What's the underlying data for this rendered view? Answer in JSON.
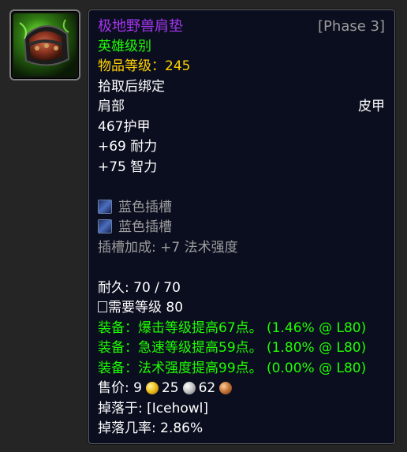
{
  "item": {
    "icon_name": "shoulder-armor-icon",
    "name": "极地野兽肩垫",
    "phase": "[Phase 3]",
    "quality": "英雄级别",
    "item_level_label": "物品等级：",
    "item_level_value": "245",
    "binding": "拾取后绑定",
    "slot": "肩部",
    "armor_type": "皮甲",
    "armor": "467护甲",
    "stats": [
      "+69 耐力",
      "+75 智力"
    ],
    "sockets": [
      "蓝色插槽",
      "蓝色插槽"
    ],
    "socket_bonus": "插槽加成: +7 法术强度",
    "durability": "耐久: 70 / 70",
    "required_level": "需要等级 80",
    "equip_effects": [
      "装备：爆击等级提高67点。 (1.46% @ L80)",
      "装备：急速等级提高59点。 (1.80% @ L80)",
      "装备：法术强度提高99点。 (0.00% @ L80)"
    ],
    "sell_price": {
      "label": "售价: ",
      "gold": "9",
      "silver": "25",
      "copper": "62"
    },
    "drop_source": "掉落于: [Icehowl]",
    "drop_rate": "掉落几率: 2.86%"
  },
  "colors": {
    "epic": "#a335ee",
    "uncommon_green": "#1eff00",
    "item_level_gold": "#ffd100",
    "phase_gray": "#9b9b9b",
    "tooltip_bg": "#0b0e1f"
  }
}
